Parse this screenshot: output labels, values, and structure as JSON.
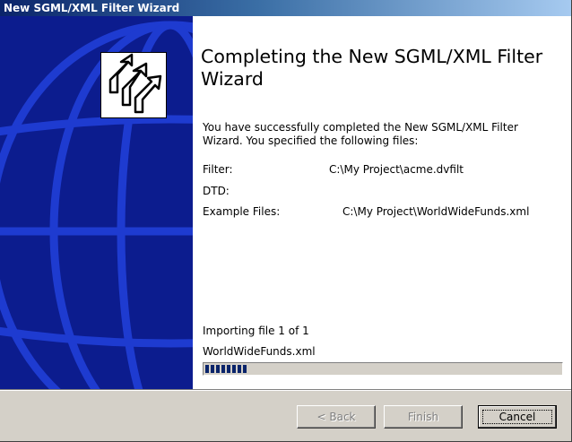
{
  "window": {
    "title": "New SGML/XML Filter Wizard"
  },
  "main": {
    "heading": "Completing the New SGML/XML Filter Wizard",
    "intro": "You have successfully completed the New SGML/XML Filter Wizard. You specified the following files:",
    "files": [
      {
        "label": "Filter:",
        "value": "C:\\My Project\\acme.dvfilt"
      },
      {
        "label": "DTD:",
        "value": ""
      },
      {
        "label": "Example Files:",
        "value": "C:\\My Project\\WorldWideFunds.xml"
      }
    ],
    "progress": {
      "status": "Importing file 1 of 1",
      "filename": "WorldWideFunds.xml",
      "percent": 12
    }
  },
  "buttons": {
    "back": "< Back",
    "finish": "Finish",
    "cancel": "Cancel"
  },
  "icons": {
    "wizard": "wizard-arrows-icon"
  },
  "colors": {
    "title_bar": "#0a246a",
    "banner": "#0c1c8e",
    "globe_lines": "#1e3bd0",
    "progress": "#0a246a"
  }
}
